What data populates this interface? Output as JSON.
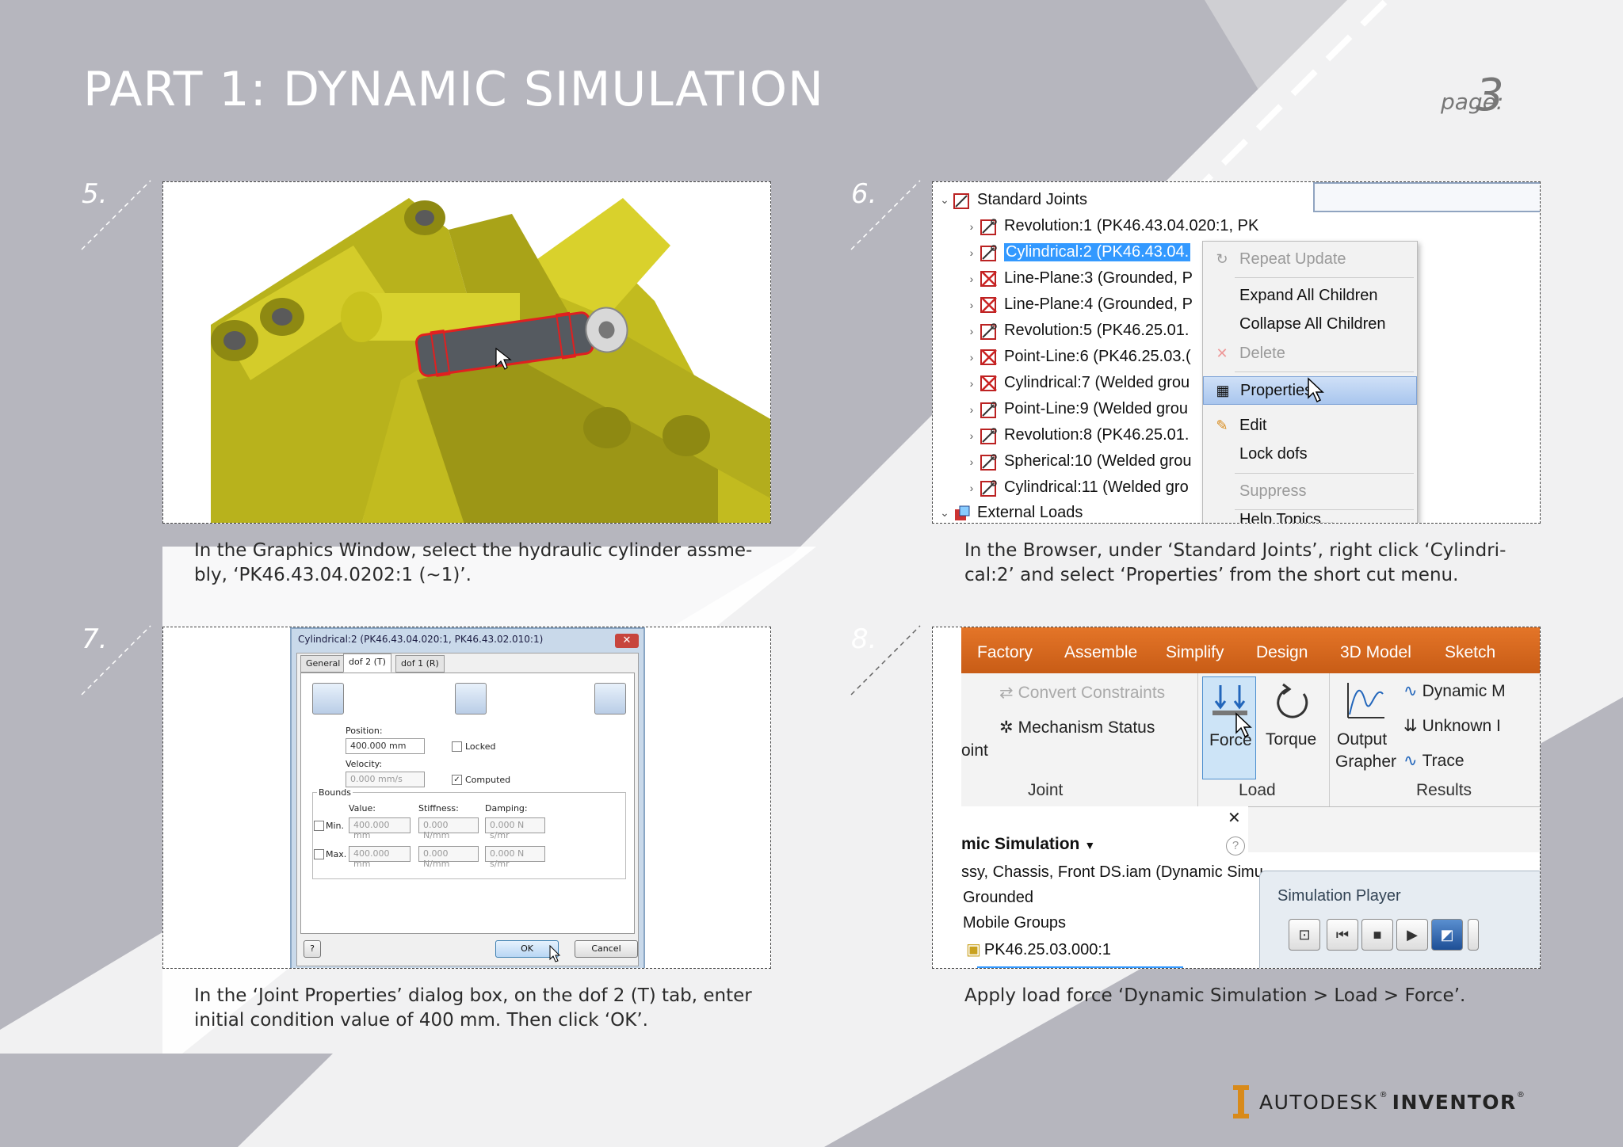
{
  "page": {
    "title": "PART 1: DYNAMIC SIMULATION",
    "page_label": "page:",
    "page_number": "3"
  },
  "steps": {
    "s5": {
      "number": "5.",
      "caption": "In the Graphics Window, select the hydraulic cylinder assme-bly, ‘PK46.43.04.0202:1 (~1)’."
    },
    "s6": {
      "number": "6.",
      "caption": "In the Browser, under ‘Standard Joints’, right click ‘Cylindri-cal:2’ and select ‘Properties’ from the short cut menu."
    },
    "s7": {
      "number": "7.",
      "caption": "In the ‘Joint Properties’ dialog box, on the dof 2 (T) tab, enter initial condition value of 400 mm.  Then click ‘OK’."
    },
    "s8": {
      "number": "8.",
      "caption": "Apply load force ‘Dynamic Simulation > Load > Force’."
    }
  },
  "browser": {
    "header": "Standard Joints",
    "items": [
      "Revolution:1 (PK46.43.04.020:1, PK",
      "Cylindrical:2 (PK46.43.04.",
      "Line-Plane:3 (Grounded, P",
      "Line-Plane:4 (Grounded, P",
      "Revolution:5 (PK46.25.01.",
      "Point-Line:6 (PK46.25.03.(",
      "Cylindrical:7 (Welded grou",
      "Point-Line:9 (Welded grou",
      "Revolution:8 (PK46.25.01.",
      "Spherical:10 (Welded grou",
      "Cylindrical:11 (Welded gro"
    ],
    "footer": "External Loads"
  },
  "context_menu": {
    "items": [
      "Repeat Update",
      "Expand All Children",
      "Collapse All Children",
      "Delete",
      "Properties",
      "Edit",
      "Lock dofs",
      "Suppress",
      "Help Topics..."
    ]
  },
  "dialog": {
    "title": "Cylindrical:2 (PK46.43.04.020:1, PK46.43.02.010:1)",
    "tabs": [
      "General",
      "dof 2 (T)",
      "dof 1 (R)"
    ],
    "position_label": "Position:",
    "position_value": "400.000 mm",
    "locked_label": "Locked",
    "velocity_label": "Velocity:",
    "velocity_value": "0.000 mm/s",
    "computed_label": "Computed",
    "bounds_label": "Bounds",
    "value_label": "Value:",
    "stiffness_label": "Stiffness:",
    "damping_label": "Damping:",
    "min_label": "Min.",
    "max_label": "Max.",
    "min_value": "400.000 mm",
    "max_value": "400.000 mm",
    "stiffness_value": "0.000 N/mm",
    "damping_value": "0.000 N s/mr",
    "ok": "OK",
    "cancel": "Cancel",
    "help": "?"
  },
  "ribbon": {
    "tabs": [
      "Factory",
      "Assemble",
      "Simplify",
      "Design",
      "3D Model",
      "Sketch"
    ],
    "convert_constraints": "Convert Constraints",
    "mechanism_status": "Mechanism Status",
    "joint_partial": "oint",
    "force": "Force",
    "torque": "Torque",
    "output_grapher_1": "Output",
    "output_grapher_2": "Grapher",
    "dynamic": "Dynamic M",
    "unknown": "Unknown I",
    "trace": "Trace",
    "group_joint": "Joint",
    "group_load": "Load",
    "group_results": "Results",
    "panel_title": "mic Simulation",
    "assembly": "ssy, Chassis, Front DS.iam (Dynamic Simu",
    "grounded": "Grounded",
    "mobile_groups": "Mobile Groups",
    "part": "PK46.25.03.000:1",
    "player_title": "Simulation Player"
  },
  "logo": {
    "brand": "AUTODESK",
    "product": "INVENTOR"
  },
  "colors": {
    "ribbon": "#e47528",
    "selection": "#3399ff",
    "model_yellow": "#c9c21e",
    "cylinder": "#5a5a60"
  }
}
